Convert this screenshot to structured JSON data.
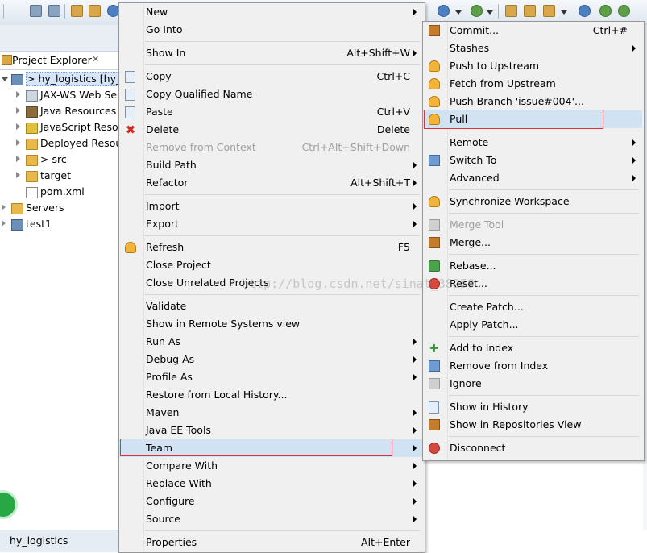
{
  "explorer": {
    "title": "Project Explorer",
    "close_glyph": "✕",
    "tree": [
      {
        "label": "> hy_logistics  [hy_l",
        "icon": "project-icon",
        "indent": 0,
        "expanded": true,
        "selected": true
      },
      {
        "label": "JAX-WS Web Se",
        "icon": "webservice-icon",
        "indent": 1
      },
      {
        "label": "Java Resources",
        "icon": "java-resources-icon",
        "indent": 1
      },
      {
        "label": "JavaScript Reso",
        "icon": "javascript-icon",
        "indent": 1
      },
      {
        "label": "Deployed Resou",
        "icon": "deployed-icon",
        "indent": 1
      },
      {
        "label": "> src",
        "icon": "folder-icon",
        "indent": 1
      },
      {
        "label": "target",
        "icon": "folder-icon",
        "indent": 1
      },
      {
        "label": "pom.xml",
        "icon": "xml-file-icon",
        "indent": 1,
        "leaf": true
      },
      {
        "label": "Servers",
        "icon": "folder-icon",
        "indent": 0
      },
      {
        "label": "test1",
        "icon": "project-icon",
        "indent": 0
      }
    ]
  },
  "status_bar": {
    "text": "hy_logistics"
  },
  "context_menu": {
    "items": [
      {
        "label": "New",
        "submenu": true
      },
      {
        "label": "Go Into"
      },
      {
        "sep": true
      },
      {
        "label": "Show In",
        "shortcut": "Alt+Shift+W",
        "submenu": true
      },
      {
        "sep": true
      },
      {
        "label": "Copy",
        "shortcut": "Ctrl+C",
        "icon": "copy-icon"
      },
      {
        "label": "Copy Qualified Name",
        "icon": "copy-qualified-icon"
      },
      {
        "label": "Paste",
        "shortcut": "Ctrl+V",
        "icon": "paste-icon"
      },
      {
        "label": "Delete",
        "shortcut": "Delete",
        "icon": "delete-icon"
      },
      {
        "label": "Remove from Context",
        "shortcut": "Ctrl+Alt+Shift+Down",
        "disabled": true
      },
      {
        "label": "Build Path",
        "submenu": true
      },
      {
        "label": "Refactor",
        "shortcut": "Alt+Shift+T",
        "submenu": true
      },
      {
        "sep": true
      },
      {
        "label": "Import",
        "submenu": true
      },
      {
        "label": "Export",
        "submenu": true
      },
      {
        "sep": true
      },
      {
        "label": "Refresh",
        "shortcut": "F5",
        "icon": "refresh-icon"
      },
      {
        "label": "Close Project"
      },
      {
        "label": "Close Unrelated Projects"
      },
      {
        "sep": true
      },
      {
        "label": "Validate"
      },
      {
        "label": "Show in Remote Systems view"
      },
      {
        "label": "Run As",
        "submenu": true
      },
      {
        "label": "Debug As",
        "submenu": true
      },
      {
        "label": "Profile As",
        "submenu": true
      },
      {
        "label": "Restore from Local History..."
      },
      {
        "label": "Maven",
        "submenu": true
      },
      {
        "label": "Java EE Tools",
        "submenu": true
      },
      {
        "label": "Team",
        "submenu": true,
        "selected": true,
        "highlighted": true
      },
      {
        "label": "Compare With",
        "submenu": true
      },
      {
        "label": "Replace With",
        "submenu": true
      },
      {
        "label": "Configure",
        "submenu": true
      },
      {
        "label": "Source",
        "submenu": true
      },
      {
        "sep": true
      },
      {
        "label": "Properties",
        "shortcut": "Alt+Enter"
      }
    ]
  },
  "team_menu": {
    "items": [
      {
        "label": "Commit...",
        "shortcut": "Ctrl+#",
        "icon": "commit-icon"
      },
      {
        "label": "Stashes",
        "submenu": true
      },
      {
        "label": "Push to Upstream",
        "icon": "push-upstream-icon"
      },
      {
        "label": "Fetch from Upstream",
        "icon": "fetch-upstream-icon"
      },
      {
        "label": "Push Branch 'issue#004'...",
        "icon": "push-branch-icon"
      },
      {
        "label": "Pull",
        "icon": "pull-icon",
        "selected": true,
        "highlighted": true
      },
      {
        "sep": true
      },
      {
        "label": "Remote",
        "submenu": true
      },
      {
        "label": "Switch To",
        "submenu": true,
        "icon": "switch-icon"
      },
      {
        "label": "Advanced",
        "submenu": true
      },
      {
        "sep": true
      },
      {
        "label": "Synchronize Workspace",
        "icon": "synchronize-icon"
      },
      {
        "sep": true
      },
      {
        "label": "Merge Tool",
        "disabled": true,
        "icon": "merge-tool-icon"
      },
      {
        "label": "Merge...",
        "icon": "merge-icon"
      },
      {
        "sep": true
      },
      {
        "label": "Rebase...",
        "icon": "rebase-icon"
      },
      {
        "label": "Reset...",
        "icon": "reset-icon"
      },
      {
        "sep": true
      },
      {
        "label": "Create Patch..."
      },
      {
        "label": "Apply Patch..."
      },
      {
        "sep": true
      },
      {
        "label": "Add to Index",
        "icon": "add-icon"
      },
      {
        "label": "Remove from Index",
        "icon": "remove-index-icon"
      },
      {
        "label": "Ignore",
        "icon": "ignore-icon"
      },
      {
        "sep": true
      },
      {
        "label": "Show in History",
        "icon": "history-icon"
      },
      {
        "label": "Show in Repositories View",
        "icon": "git-repo-icon"
      },
      {
        "sep": true
      },
      {
        "label": "Disconnect",
        "icon": "disconnect-icon"
      }
    ]
  },
  "watermark": "http://blog.csdn.net/sinat_38259",
  "colors": {
    "selection": "#d1e2f2",
    "highlight_box": "#e0303a",
    "menu_bg": "#f0f0f0"
  }
}
